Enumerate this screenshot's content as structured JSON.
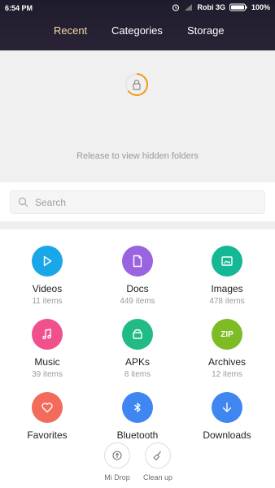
{
  "status_bar": {
    "time": "6:54 PM",
    "carrier": "Robi 3G",
    "battery": "100%"
  },
  "tabs": [
    {
      "label": "Recent",
      "active": true
    },
    {
      "label": "Categories",
      "active": false
    },
    {
      "label": "Storage",
      "active": false
    }
  ],
  "hidden_folders": {
    "hint": "Release to view hidden folders",
    "icon": "lock-icon",
    "ring_color": "#f39c12"
  },
  "search": {
    "placeholder": "Search",
    "icon": "search-icon"
  },
  "categories": [
    {
      "name": "Videos",
      "count": "11 items",
      "icon": "play-icon",
      "color": "#1aa7e8"
    },
    {
      "name": "Docs",
      "count": "449 items",
      "icon": "document-icon",
      "color": "#9a63e0"
    },
    {
      "name": "Images",
      "count": "478 items",
      "icon": "image-icon",
      "color": "#14b894"
    },
    {
      "name": "Music",
      "count": "39 items",
      "icon": "music-note-icon",
      "color": "#f0508c"
    },
    {
      "name": "APKs",
      "count": "8 items",
      "icon": "android-icon",
      "color": "#22bb85"
    },
    {
      "name": "Archives",
      "count": "12 items",
      "icon": "zip-icon",
      "color": "#7dbc24",
      "icon_text": "ZIP"
    },
    {
      "name": "Favorites",
      "count": "",
      "icon": "heart-icon",
      "color": "#f26b5b"
    },
    {
      "name": "Bluetooth",
      "count": "",
      "icon": "bluetooth-icon",
      "color": "#3f86f0"
    },
    {
      "name": "Downloads",
      "count": "",
      "icon": "download-icon",
      "color": "#3f86f0"
    }
  ],
  "actions": [
    {
      "label": "Mi Drop",
      "icon": "mi-drop-icon"
    },
    {
      "label": "Clean up",
      "icon": "broom-icon"
    }
  ]
}
